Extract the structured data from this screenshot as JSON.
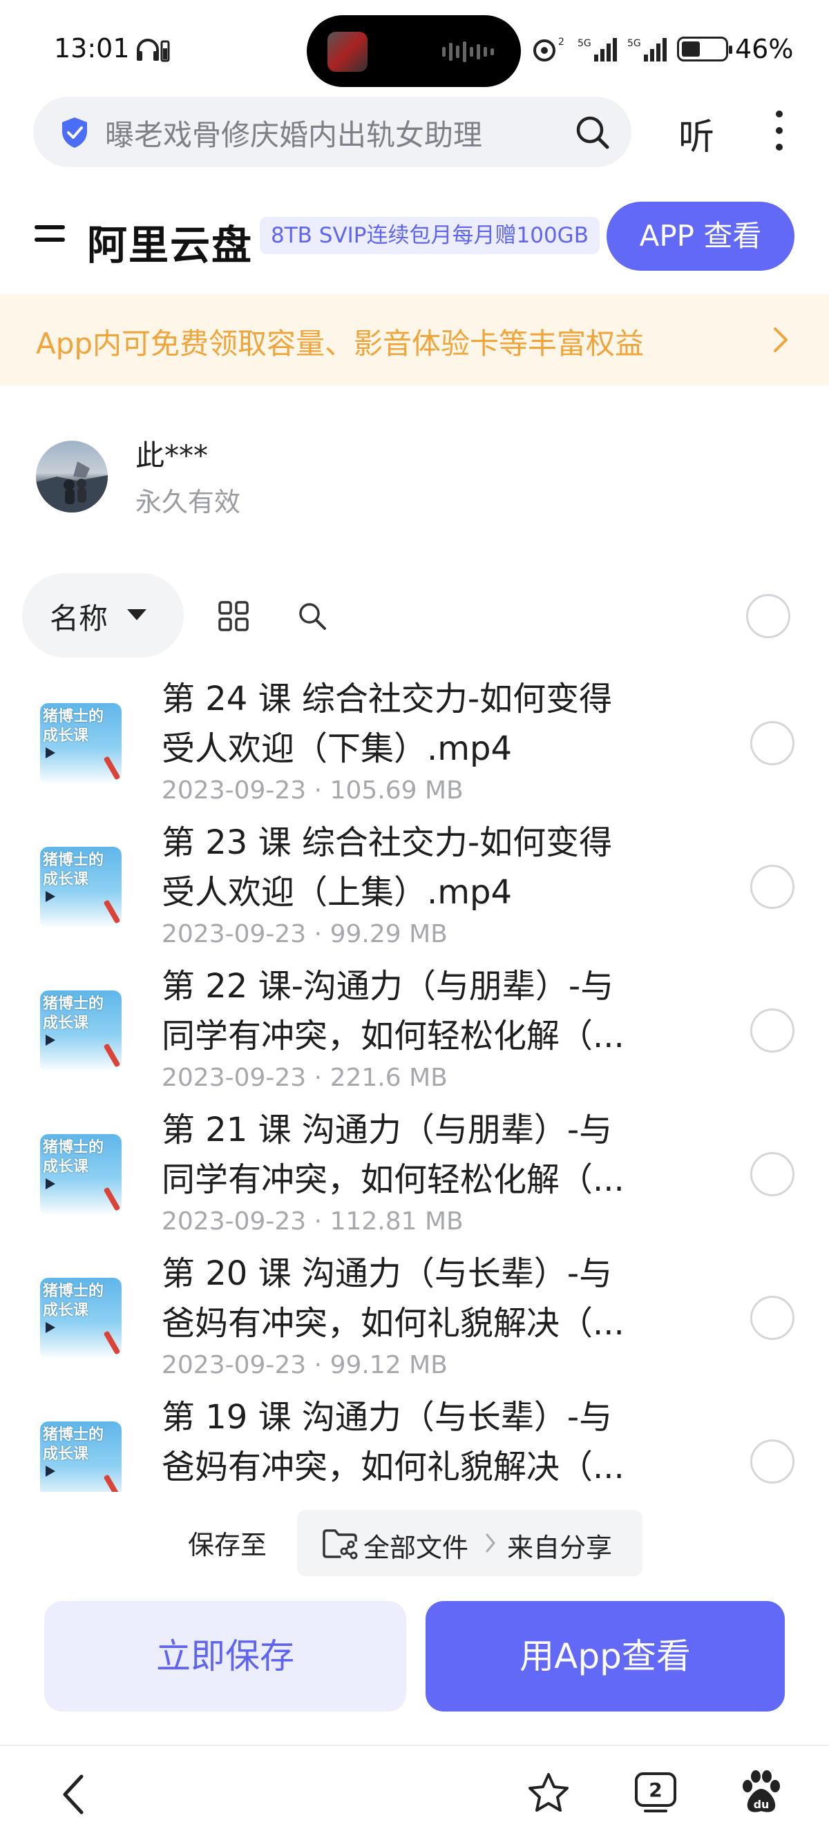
{
  "status_bar": {
    "time": "13:01",
    "network_5g_a": "5G",
    "network_5g_b": "5G",
    "battery_percent": "46%",
    "icons": [
      "headset-icon",
      "battery-small-icon",
      "hotspot-icon",
      "signal-icon",
      "battery-icon"
    ]
  },
  "browser": {
    "search_text": "曝老戏骨修庆婚内出轨女助理",
    "listen_label": "听",
    "icons": [
      "shield-icon",
      "search-icon",
      "more-icon"
    ]
  },
  "header": {
    "brand": "阿里云盘",
    "promo_tag": "8TB SVIP连续包月每月赠100GB",
    "app_view_button": "APP 查看"
  },
  "banner": {
    "text": "App内可免费领取容量、影音体验卡等丰富权益"
  },
  "sharer": {
    "name": "此***",
    "validity": "永久有效"
  },
  "toolbar": {
    "sort_label": "名称"
  },
  "thumbnail": {
    "line1": "猪博士的",
    "line2": "成长课"
  },
  "files": [
    {
      "line1": "第 24 课 综合社交力-如何变得",
      "line2": "受人欢迎（下集）.mp4",
      "date": "2023-09-23",
      "size": "105.69 MB"
    },
    {
      "line1": "第 23 课 综合社交力-如何变得",
      "line2": "受人欢迎（上集）.mp4",
      "date": "2023-09-23",
      "size": "99.29 MB"
    },
    {
      "line1": "第 22 课-沟通力（与朋辈）-与",
      "line2": "同学有冲突，如何轻松化解（...",
      "date": "2023-09-23",
      "size": "221.6 MB"
    },
    {
      "line1": "第 21 课 沟通力（与朋辈）-与",
      "line2": "同学有冲突，如何轻松化解（...",
      "date": "2023-09-23",
      "size": "112.81 MB"
    },
    {
      "line1": "第 20 课 沟通力（与长辈）-与",
      "line2": "爸妈有冲突，如何礼貌解决（...",
      "date": "2023-09-23",
      "size": "99.12 MB"
    },
    {
      "line1": "第 19 课 沟通力（与长辈）-与",
      "line2": "爸妈有冲突，如何礼貌解决（...",
      "date": "",
      "size": ""
    }
  ],
  "save_path": {
    "label": "保存至",
    "root": "全部文件",
    "leaf": "来自分享"
  },
  "actions": {
    "save_now": "立即保存",
    "open_in_app": "用App查看"
  },
  "bottom_nav": {
    "tab_count": "2",
    "icons": [
      "back-icon",
      "star-icon",
      "tabs-icon",
      "baidu-icon"
    ]
  }
}
